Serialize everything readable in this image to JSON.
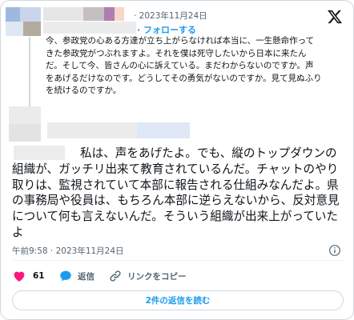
{
  "header": {
    "date": "· 2023年11月24日",
    "follow_label": "· フォローする",
    "logo_icon": "x-logo-icon"
  },
  "quoted_post": {
    "text": "今、参政党の心ある方達が立ち上がらなければ本当に、一生懸命作ってきた参政党がつぶれますよ。それを僕は死守したいから日本に来たんだ。そして今、皆さんの心に訴えている。まだわからないのですか。声をあげるだけなのです。どうしてその勇気がないのですか。見て見ぬふりを続けるのですか。"
  },
  "reply": {
    "text": "私は、声をあげたよ。でも、縦のトップダウンの組織が、ガッチリ出来て教育されているんだ。チャットのやり取りは、監視されていて本部に報告される仕組みなんだよ。県の事務局や役員は、もちろん本部に逆らえないから、反対意見について何も言えないんだ。そういう組織が出来上がっていたよ",
    "timestamp": "午前9:58 · 2023年11月24日"
  },
  "actions": {
    "like_count": "61",
    "reply_label": "返信",
    "copy_link_label": "リンクをコピー"
  },
  "read_replies_label": "2件の返信を読む",
  "colors": {
    "accent": "#1d9bf0",
    "like": "#f91880",
    "muted": "#536471"
  }
}
